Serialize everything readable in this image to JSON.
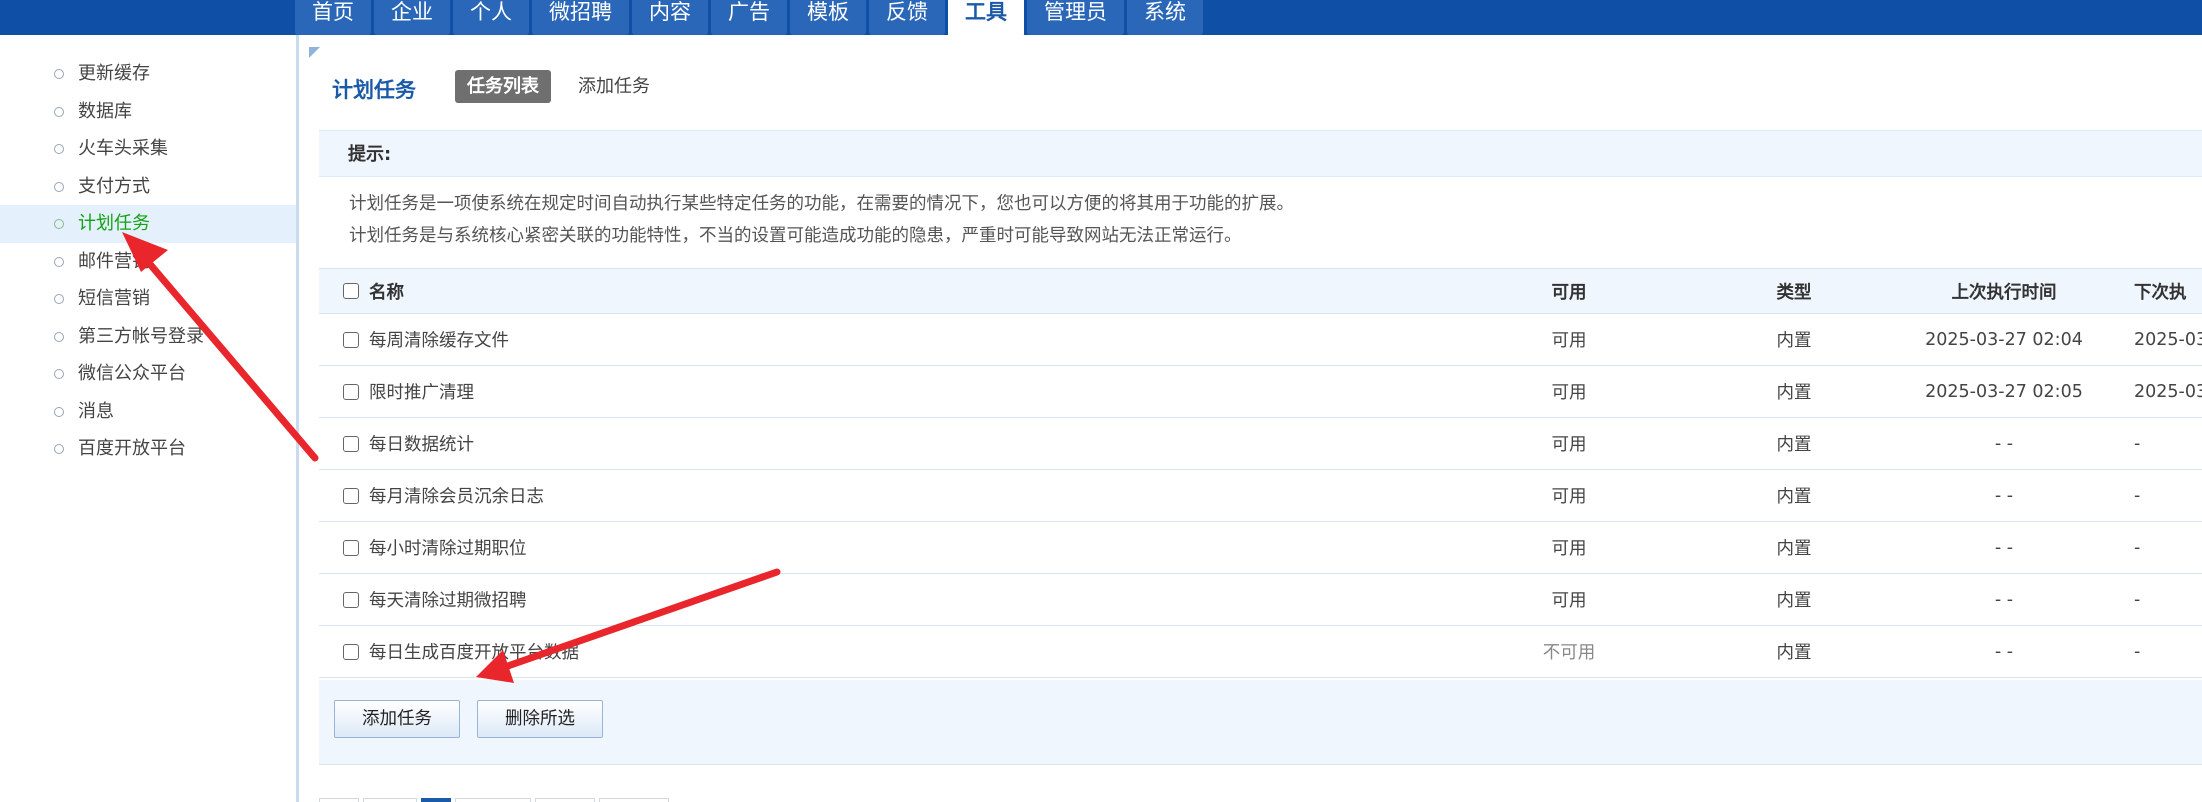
{
  "topnav": {
    "tabs": [
      {
        "label": "首页",
        "active": false
      },
      {
        "label": "企业",
        "active": false
      },
      {
        "label": "个人",
        "active": false
      },
      {
        "label": "微招聘",
        "active": false
      },
      {
        "label": "内容",
        "active": false
      },
      {
        "label": "广告",
        "active": false
      },
      {
        "label": "模板",
        "active": false
      },
      {
        "label": "反馈",
        "active": false
      },
      {
        "label": "工具",
        "active": true
      },
      {
        "label": "管理员",
        "active": false
      },
      {
        "label": "系统",
        "active": false
      }
    ]
  },
  "sidebar": {
    "items": [
      {
        "label": "更新缓存",
        "active": false
      },
      {
        "label": "数据库",
        "active": false
      },
      {
        "label": "火车头采集",
        "active": false
      },
      {
        "label": "支付方式",
        "active": false
      },
      {
        "label": "计划任务",
        "active": true
      },
      {
        "label": "邮件营销",
        "active": false
      },
      {
        "label": "短信营销",
        "active": false
      },
      {
        "label": "第三方帐号登录",
        "active": false
      },
      {
        "label": "微信公众平台",
        "active": false
      },
      {
        "label": "消息",
        "active": false
      },
      {
        "label": "百度开放平台",
        "active": false
      }
    ]
  },
  "main": {
    "title": "计划任务",
    "tabs": {
      "list": "任务列表",
      "add": "添加任务"
    },
    "tips": {
      "heading": "提示:",
      "lines": [
        "计划任务是一项使系统在规定时间自动执行某些特定任务的功能，在需要的情况下，您也可以方便的将其用于功能的扩展。",
        "计划任务是与系统核心紧密关联的功能特性，不当的设置可能造成功能的隐患，严重时可能导致网站无法正常运行。"
      ]
    },
    "table": {
      "headers": {
        "name": "名称",
        "available": "可用",
        "type": "类型",
        "last_run": "上次执行时间",
        "next_run": "下次执"
      },
      "rows": [
        {
          "name": "每周清除缓存文件",
          "available": "可用",
          "type": "内置",
          "last_run": "2025-03-27 02:04",
          "next_run": "2025-03"
        },
        {
          "name": "限时推广清理",
          "available": "可用",
          "type": "内置",
          "last_run": "2025-03-27 02:05",
          "next_run": "2025-03"
        },
        {
          "name": "每日数据统计",
          "available": "可用",
          "type": "内置",
          "last_run": "- -",
          "next_run": "-"
        },
        {
          "name": "每月清除会员沉余日志",
          "available": "可用",
          "type": "内置",
          "last_run": "- -",
          "next_run": "-"
        },
        {
          "name": "每小时清除过期职位",
          "available": "可用",
          "type": "内置",
          "last_run": "- -",
          "next_run": "-"
        },
        {
          "name": "每天清除过期微招聘",
          "available": "可用",
          "type": "内置",
          "last_run": "- -",
          "next_run": "-"
        },
        {
          "name": "每日生成百度开放平台数据",
          "available": "不可用",
          "type": "内置",
          "last_run": "- -",
          "next_run": "-"
        }
      ]
    },
    "actions": {
      "add": "添加任务",
      "delete": "删除所选"
    }
  },
  "colors": {
    "nav_bg": "#0f4fa6",
    "active_sidebar_text": "#12a312",
    "title_blue": "#1a5aa8",
    "annotation_arrow": "#e8262b"
  }
}
